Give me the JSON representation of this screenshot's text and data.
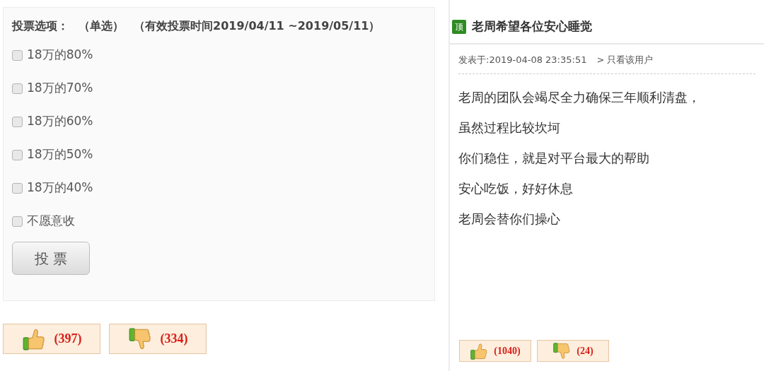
{
  "poll": {
    "title": [
      "投票选项：",
      "（单选）",
      "（有效投票时间2019/04/11 ~2019/05/11）"
    ],
    "options": [
      {
        "label": "18万的80%",
        "checked": false
      },
      {
        "label": "18万的70%",
        "checked": false
      },
      {
        "label": "18万的60%",
        "checked": false
      },
      {
        "label": "18万的50%",
        "checked": false
      },
      {
        "label": "18万的40%",
        "checked": false
      },
      {
        "label": "不愿意收",
        "checked": false
      }
    ],
    "submit": "投 票",
    "reactions": [
      {
        "kind": "up",
        "count": "(397)"
      },
      {
        "kind": "down",
        "count": "(334)"
      }
    ]
  },
  "post": {
    "badge": "顶",
    "title": "老周希望各位安心睡觉",
    "posted": "发表于:2019-04-08 23:35:51",
    "filter": "> 只看该用户",
    "lines": [
      "老周的团队会竭尽全力确保三年顺利清盘，",
      "虽然过程比较坎坷",
      "你们稳住，就是对平台最大的帮助",
      "安心吃饭，好好休息",
      "老周会替你们操心"
    ],
    "reactions": [
      {
        "kind": "up",
        "count": "(1040)"
      },
      {
        "kind": "down",
        "count": "(24)"
      }
    ]
  }
}
